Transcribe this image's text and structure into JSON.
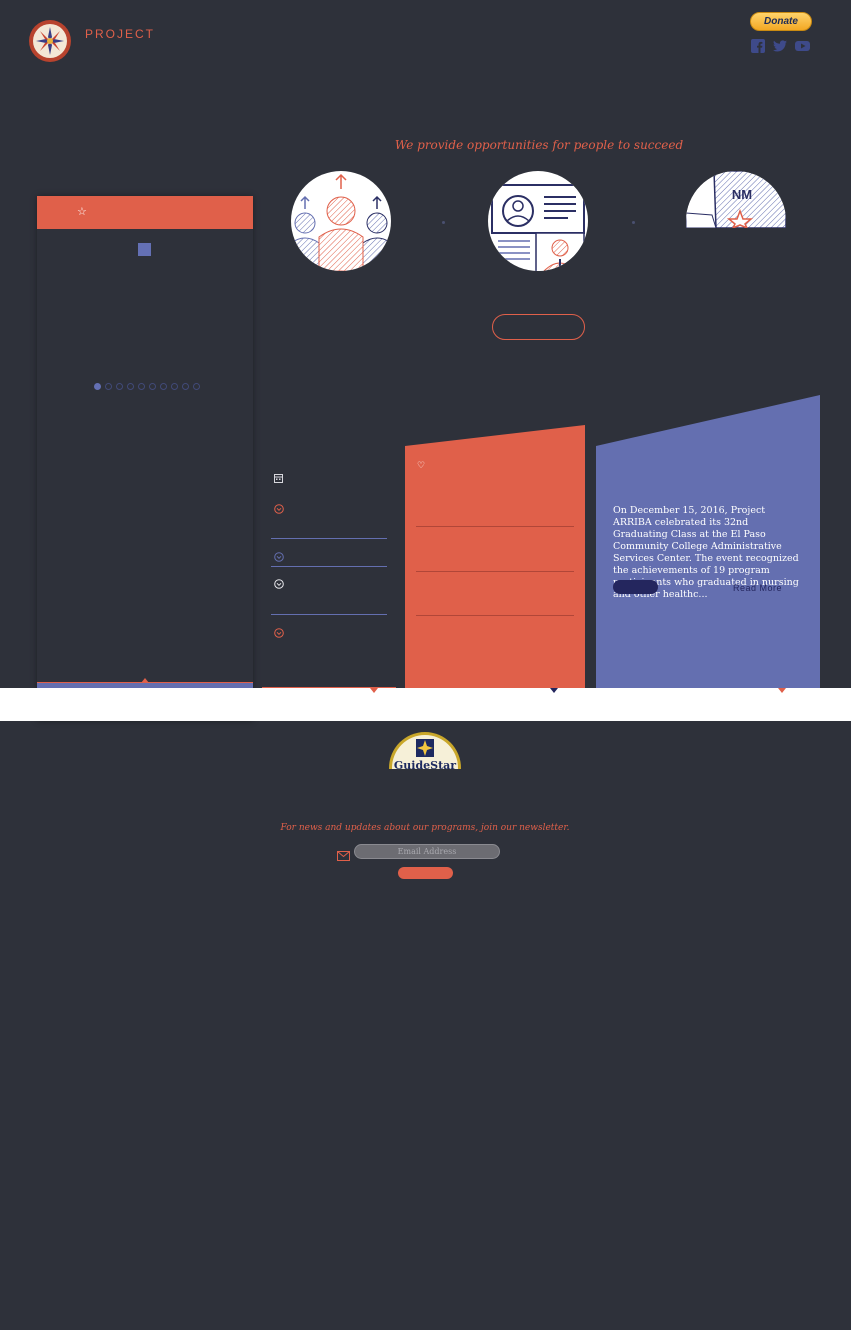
{
  "header": {
    "brand_text": "PROJECT",
    "donate_label": "Donate",
    "social_icons": [
      "facebook-icon",
      "twitter-icon",
      "youtube-icon"
    ]
  },
  "hero": {
    "tagline": "We provide opportunities for people to succeed",
    "illustrations": [
      "people-growth-icon",
      "id-card-icon",
      "new-mexico-map-icon"
    ],
    "map_label": "NM"
  },
  "stories": {
    "header_icon": "star-icon",
    "carousel_page_count": 10,
    "carousel_active_index": 0
  },
  "news": {
    "text": "On December 15, 2016, Project ARRIBA celebrated its 32nd Graduating Class at the El Paso Community College Administrative Services Center. The event recognized the achievements of 19 program participants who graduated in nursing and other healthc...",
    "read_more_label": "Read More"
  },
  "guidestar": {
    "label": "GuideStar"
  },
  "newsletter": {
    "text": "For news and updates about our programs, join our newsletter.",
    "email_placeholder": "Email Address"
  },
  "colors": {
    "background": "#2e313a",
    "accent_red": "#e0604a",
    "accent_blue": "#646fb0",
    "navy": "#24265e"
  }
}
